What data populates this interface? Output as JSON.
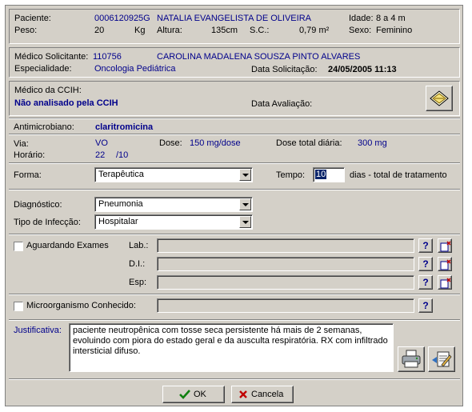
{
  "patient": {
    "label": "Paciente:",
    "id": "0006120925G",
    "name": "NATALIA EVANGELISTA DE OLIVEIRA",
    "age_label": "Idade:",
    "age": "8 a 4 m",
    "weight_label": "Peso:",
    "weight": "20",
    "weight_unit": "Kg",
    "height_label": "Altura:",
    "height": "135cm",
    "sc_label": "S.C.:",
    "sc": "0,79 m²",
    "sex_label": "Sexo:",
    "sex": "Feminino"
  },
  "requester": {
    "label": "Médico Solicitante:",
    "id": "110756",
    "name": "CAROLINA MADALENA SOUSZA PINTO ALVARES",
    "specialty_label": "Especialidade:",
    "specialty": "Oncologia Pediátrica",
    "date_label": "Data Solicitação:",
    "date": "24/05/2005 11:13"
  },
  "ccih": {
    "label": "Médico da CCIH:",
    "status": "Não analisado pela CCIH",
    "eval_label": "Data Avaliação:"
  },
  "antimicrobial": {
    "label": "Antimicrobiano:",
    "name": "claritromicina",
    "route_label": "Via:",
    "route": "VO",
    "dose_label": "Dose:",
    "dose": "150 mg/dose",
    "total_label": "Dose total diária:",
    "total": "300 mg",
    "schedule_label": "Horário:",
    "schedule_a": "22",
    "schedule_b": "/10",
    "form_label": "Forma:",
    "form_value": "Terapêutica",
    "time_label": "Tempo:",
    "time_value": "10",
    "time_suffix": "dias - total de tratamento"
  },
  "diagnosis": {
    "label": "Diagnóstico:",
    "value": "Pneumonia",
    "infection_label": "Tipo de Infecção:",
    "infection_value": "Hospitalar"
  },
  "exams": {
    "waiting_label": "Aguardando Exames",
    "lab_label": "Lab.:",
    "di_label": "D.I.:",
    "esp_label": "Esp:",
    "known_label": "Microorganismo Conhecido:",
    "help_text": "?"
  },
  "justification": {
    "label": "Justificativa:",
    "text": "paciente neutropênica com tosse seca persistente há mais de 2 semanas, evoluindo com piora do estado geral e da ausculta respiratória. RX com infiltrado intersticial difuso."
  },
  "footer": {
    "ok_label": "OK",
    "cancel_label": "Cancela"
  }
}
